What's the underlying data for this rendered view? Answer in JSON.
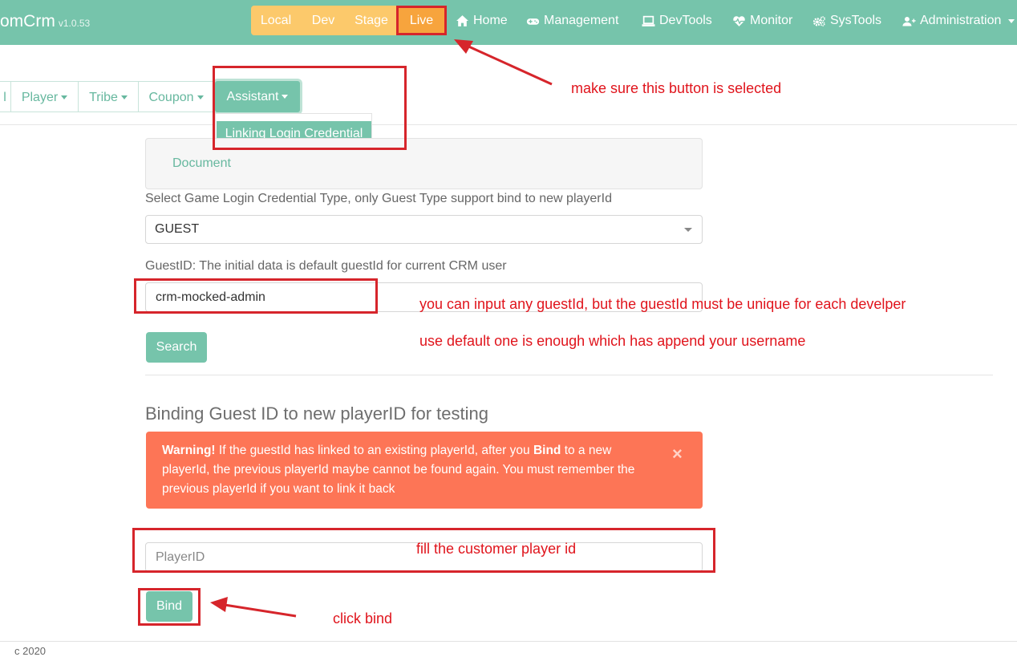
{
  "brand": {
    "name": "omCrm",
    "version": "v1.0.53"
  },
  "env": {
    "local": "Local",
    "dev": "Dev",
    "stage": "Stage",
    "live": "Live"
  },
  "nav": [
    {
      "label": "Home",
      "icon": "home-icon"
    },
    {
      "label": "Management",
      "icon": "gamepad-icon"
    },
    {
      "label": "DevTools",
      "icon": "laptop-icon"
    },
    {
      "label": "Monitor",
      "icon": "heartbeat-icon"
    },
    {
      "label": "SysTools",
      "icon": "cogs-icon"
    },
    {
      "label": "Administration",
      "icon": "user-plus-icon"
    }
  ],
  "subnav": {
    "partial": "l",
    "player": "Player",
    "tribe": "Tribe",
    "coupon": "Coupon",
    "assistant": "Assistant",
    "dropdown_item": "Linking Login Credential"
  },
  "document": {
    "link": "Document"
  },
  "form": {
    "type_label": "Select Game Login Credential Type, only Guest Type support bind to new playerId",
    "type_value": "GUEST",
    "guest_label": "GuestID: The initial data is default guestId for current CRM user",
    "guest_value": "crm-mocked-admin",
    "search_label": "Search"
  },
  "binding": {
    "heading": "Binding Guest ID to new playerID for testing",
    "warning_strong": "Warning!",
    "warning_part1": " If the guestId has linked to an existing playerId, after you ",
    "warning_bind": "Bind",
    "warning_part2": " to a new playerId, the previous playerId maybe cannot be found again. You must remember the previous playerId if you want to link it back",
    "close": "×",
    "player_placeholder": "PlayerID",
    "bind_label": "Bind"
  },
  "footer": {
    "text": "c 2020"
  },
  "annotations": {
    "live": "make  sure this button is selected",
    "guest1": "you can input any guestId, but the guestId must be unique for each develper",
    "guest2": "use default one is enough which has append your username",
    "player": "fill the customer player id",
    "bind": "click bind"
  },
  "colors": {
    "navbar": "#76c4ab",
    "env": "#fcc96b",
    "warning": "#fd7556",
    "annotation": "#e0141c"
  }
}
